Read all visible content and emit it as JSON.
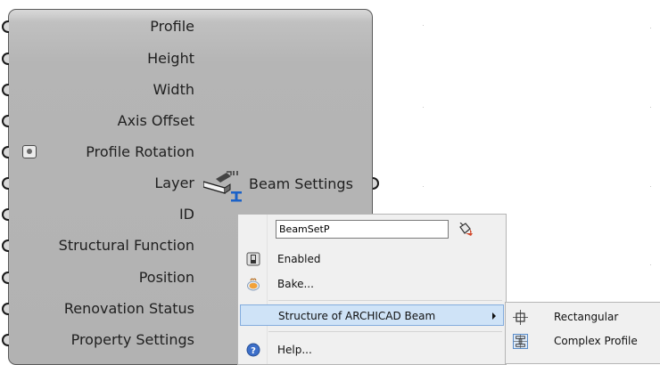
{
  "component": {
    "name": "Beam Settings",
    "inputs": [
      {
        "label": "Profile"
      },
      {
        "label": "Height"
      },
      {
        "label": "Width"
      },
      {
        "label": "Axis Offset"
      },
      {
        "label": "Profile Rotation"
      },
      {
        "label": "Layer"
      },
      {
        "label": "ID"
      },
      {
        "label": "Structural Function"
      },
      {
        "label": "Position"
      },
      {
        "label": "Renovation Status"
      },
      {
        "label": "Property Settings"
      }
    ]
  },
  "context_menu": {
    "name_field_value": "BeamSetP",
    "items": {
      "enabled": "Enabled",
      "bake": "Bake...",
      "structure": "Structure of ARCHICAD Beam",
      "help": "Help..."
    }
  },
  "submenu": {
    "items": [
      "Rectangular",
      "Complex Profile"
    ]
  },
  "icons": {
    "enabled": "checkbox-icon",
    "bake": "bake-icon",
    "help": "help-icon",
    "rectangular": "rectangular-profile-icon",
    "complex": "complex-profile-icon",
    "preview": "paint-bucket-icon"
  },
  "colors": {
    "component_fill": "#b5b5b5",
    "highlight": "#cfe3f7",
    "menu_bg": "#f0f0f0"
  }
}
